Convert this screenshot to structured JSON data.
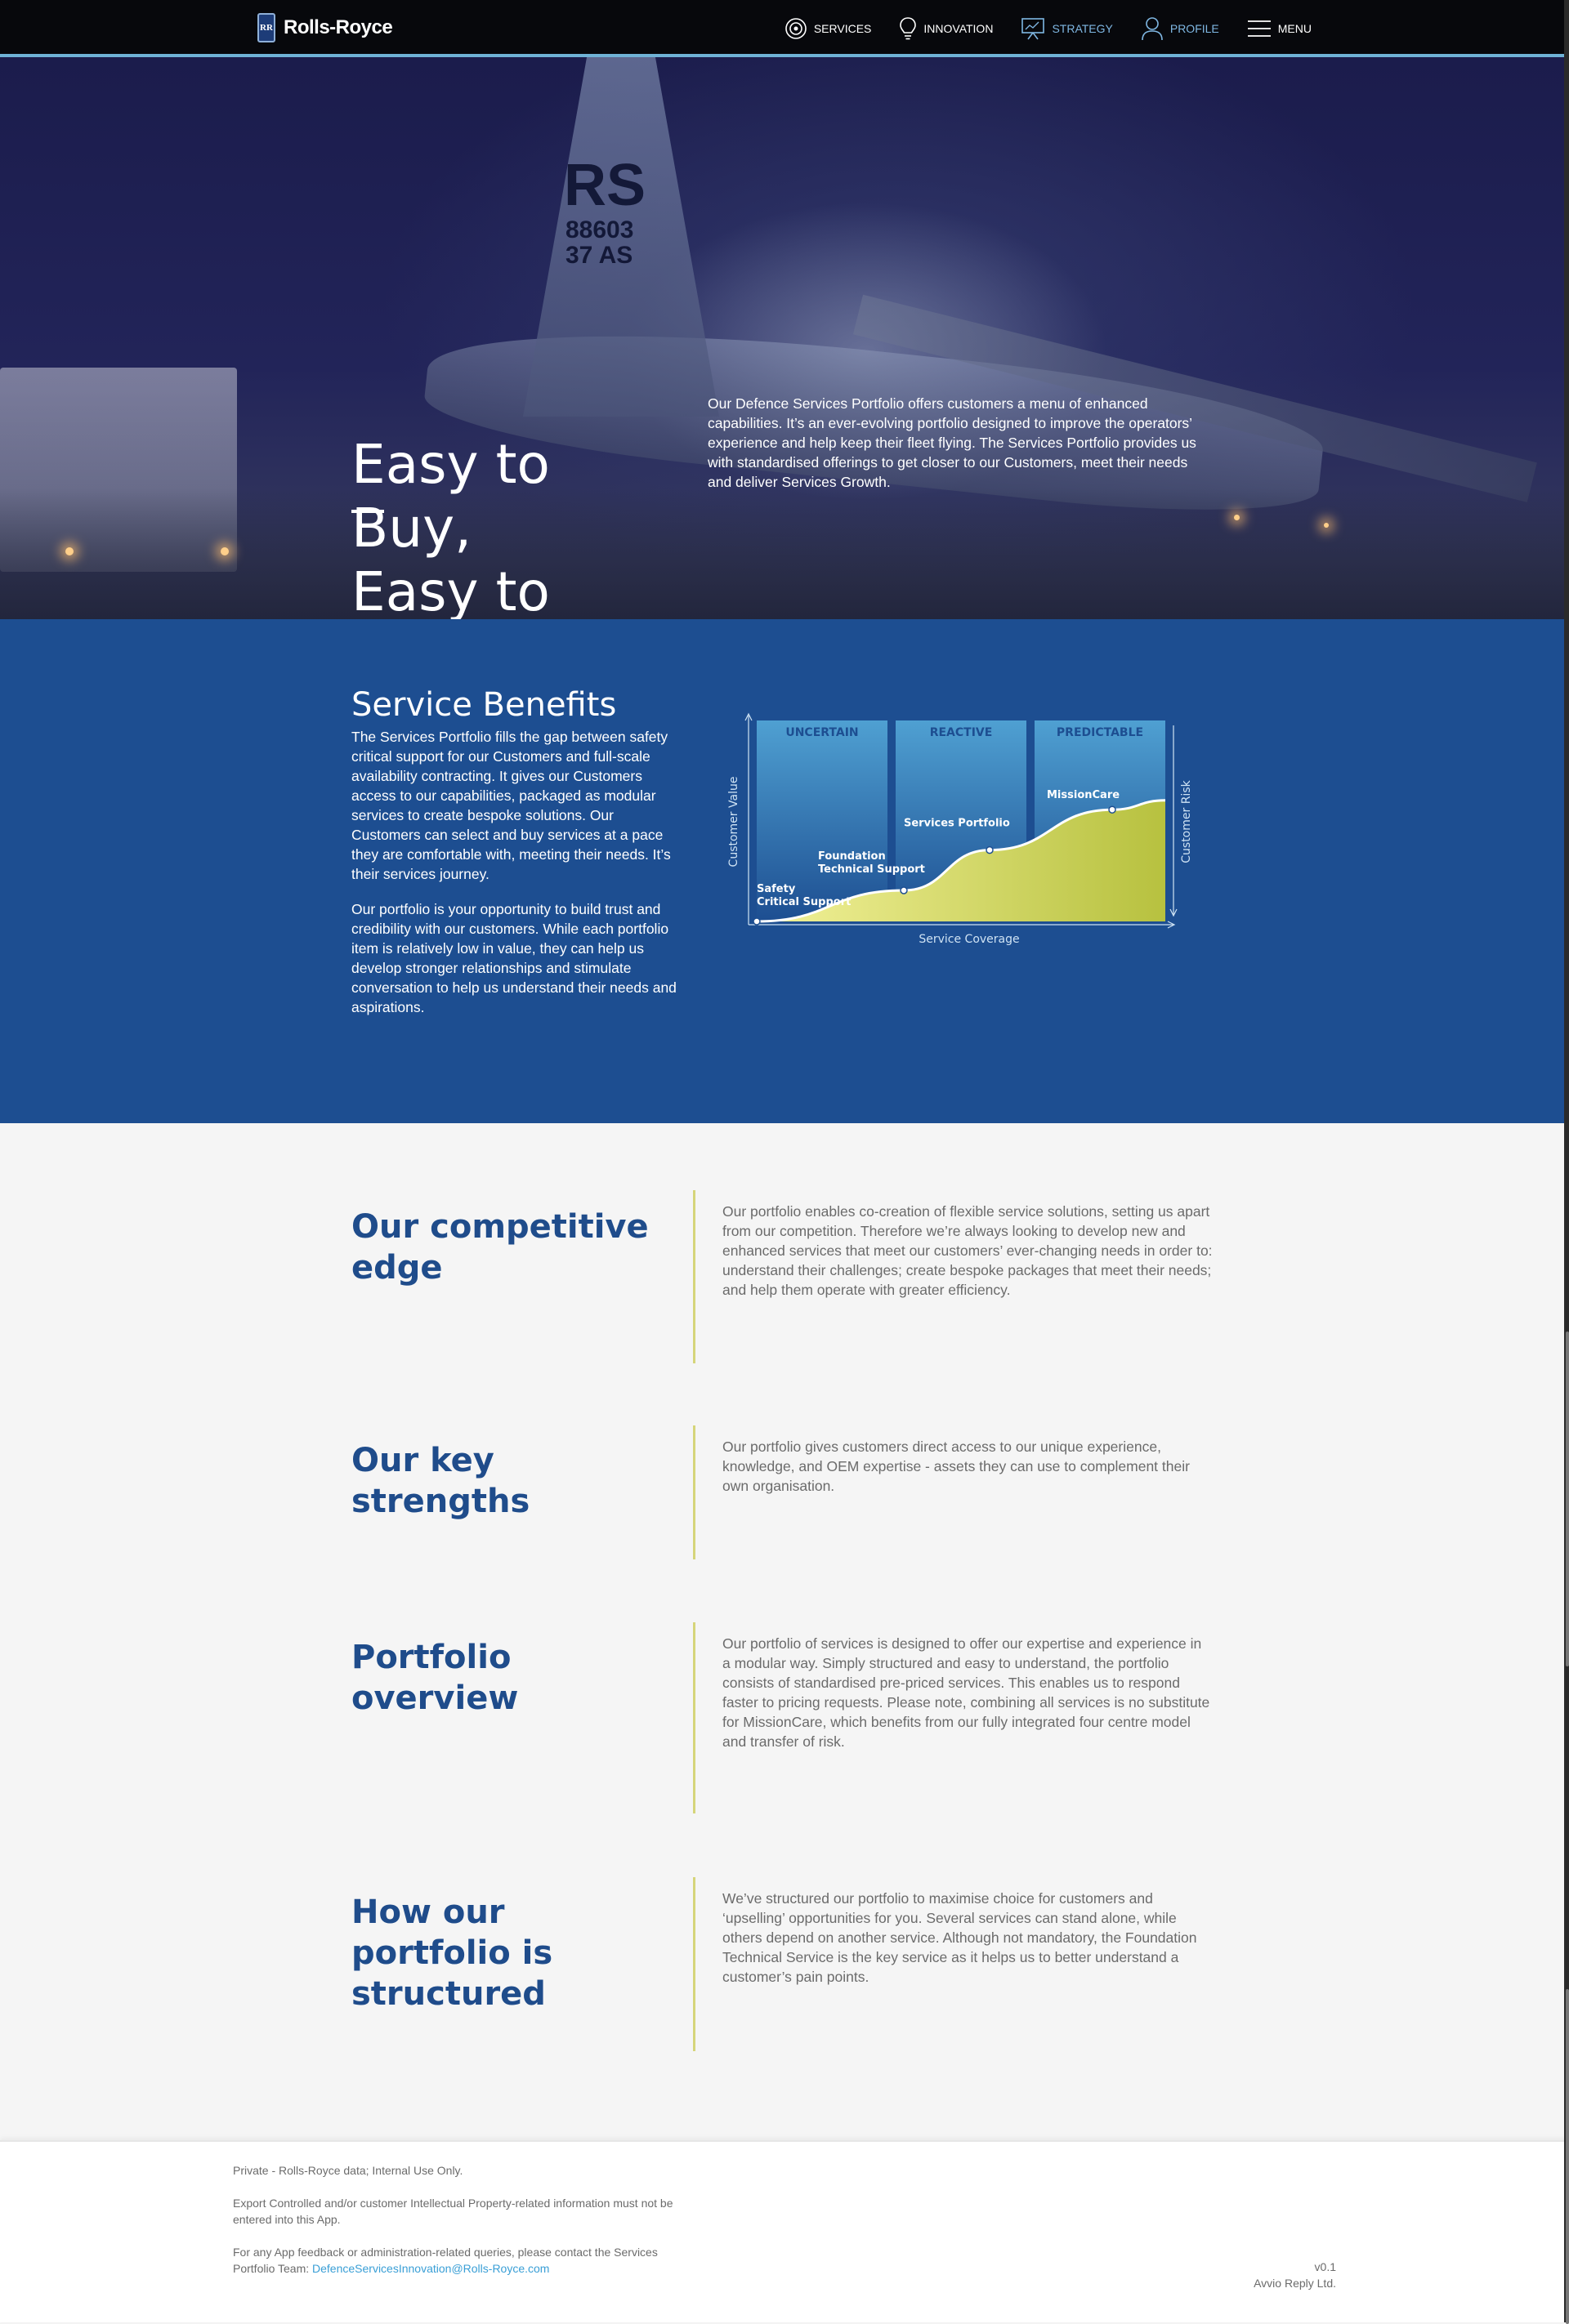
{
  "brand": {
    "name": "Rolls-Royce",
    "badge": "RR"
  },
  "nav": {
    "items": [
      {
        "label": "Services",
        "icon": "target-icon",
        "active": false
      },
      {
        "label": "Innovation",
        "icon": "lightbulb-icon",
        "active": false
      },
      {
        "label": "Strategy",
        "icon": "presentation-board-icon",
        "active": true
      },
      {
        "label": "Profile",
        "icon": "user-icon",
        "active": true
      },
      {
        "label": "Menu",
        "icon": "hamburger-icon",
        "active": false
      }
    ],
    "accent_color": "#6fb2d6",
    "active_color": "#7fb7e3"
  },
  "hero": {
    "tail_code": "RS",
    "tail_number": "88603",
    "tail_unit": "37 AS",
    "title_line1": "Easy to Buy,",
    "title_line2": "Easy to Sell",
    "description": "Our Defence Services Portfolio offers customers a menu of enhanced capabilities. It’s an ever-evolving portfolio designed to improve the operators’ experience and help keep their fleet flying. The Services Portfolio provides us with standardised offerings to get closer to our Customers, meet their needs and deliver Services Growth."
  },
  "benefits": {
    "title": "Service Benefits",
    "paragraph1": "The Services Portfolio fills the gap between safety critical support for our Customers and full-scale availability contracting. It gives our Customers access to our capabilities, packaged as modular services to create bespoke solutions. Our Customers can select and buy services at a pace they are comfortable with, meeting their needs. It’s their services journey.",
    "paragraph2": "Our portfolio is your opportunity to build trust and credibility with our customers. While each portfolio item is relatively low in value, they can help us develop stronger relationships and stimulate conversation to help us understand their needs and aspirations.",
    "background_color": "#1d4e91"
  },
  "chart_data": {
    "type": "area",
    "columns": [
      "UNCERTAIN",
      "REACTIVE",
      "PREDICTABLE"
    ],
    "xlabel": "Service Coverage",
    "ylabel_left": "Customer Value",
    "ylabel_right": "Customer Risk",
    "points": [
      {
        "label": "Safety Critical Support",
        "label_lines": [
          "Safety",
          "Critical Support"
        ],
        "x": 0.0,
        "y": 0.0
      },
      {
        "label": "Foundation Technical Support",
        "label_lines": [
          "Foundation",
          "Technical Support"
        ],
        "x": 0.36,
        "y": 0.2
      },
      {
        "label": "Services Portfolio",
        "label_lines": [
          "Services Portfolio"
        ],
        "x": 0.57,
        "y": 0.46
      },
      {
        "label": "MissionCare",
        "label_lines": [
          "MissionCare"
        ],
        "x": 0.87,
        "y": 0.72
      }
    ],
    "fill_color": "#cdd45c",
    "column_color": "#3f8fc6"
  },
  "info_rows": [
    {
      "title": "Our competitive edge",
      "text": "Our portfolio enables co-creation of flexible service solutions, setting us apart from our competition. Therefore we’re always looking to develop new and enhanced services that meet our customers’ ever-changing needs in order to: understand their challenges; create bespoke packages that meet their needs; and help them operate with greater efficiency."
    },
    {
      "title": "Our key strengths",
      "text": "Our portfolio gives customers direct access to our unique experience, knowledge, and OEM expertise - assets they can use to complement their own organisation."
    },
    {
      "title": "Portfolio overview",
      "text": "Our portfolio of services is designed to offer our expertise and experience in a modular way. Simply structured and easy to understand, the portfolio consists of standardised pre-priced services. This enables us to respond faster to pricing requests. Please note, combining all services is no substitute for MissionCare, which benefits from our fully integrated four centre model and transfer of risk."
    },
    {
      "title": "How our portfolio is structured",
      "text": "We’ve structured our portfolio to maximise choice for customers and ‘upselling’ opportunities for you. Several services can stand alone, while others depend on another service. Although not mandatory, the Foundation Technical Service is the key service as it helps us to better understand a customer’s pain points."
    }
  ],
  "footer": {
    "privacy": "Private - Rolls-Royce data; Internal Use Only.",
    "export_notice": "Export Controlled and/or customer Intellectual Property-related information must not be entered into this App.",
    "feedback_prefix": "For any App feedback or administration-related queries, please contact the Services Portfolio Team: ",
    "feedback_email": "DefenceServicesInnovation@Rolls-Royce.com",
    "version": "v0.1",
    "company": "Avvio Reply Ltd."
  }
}
